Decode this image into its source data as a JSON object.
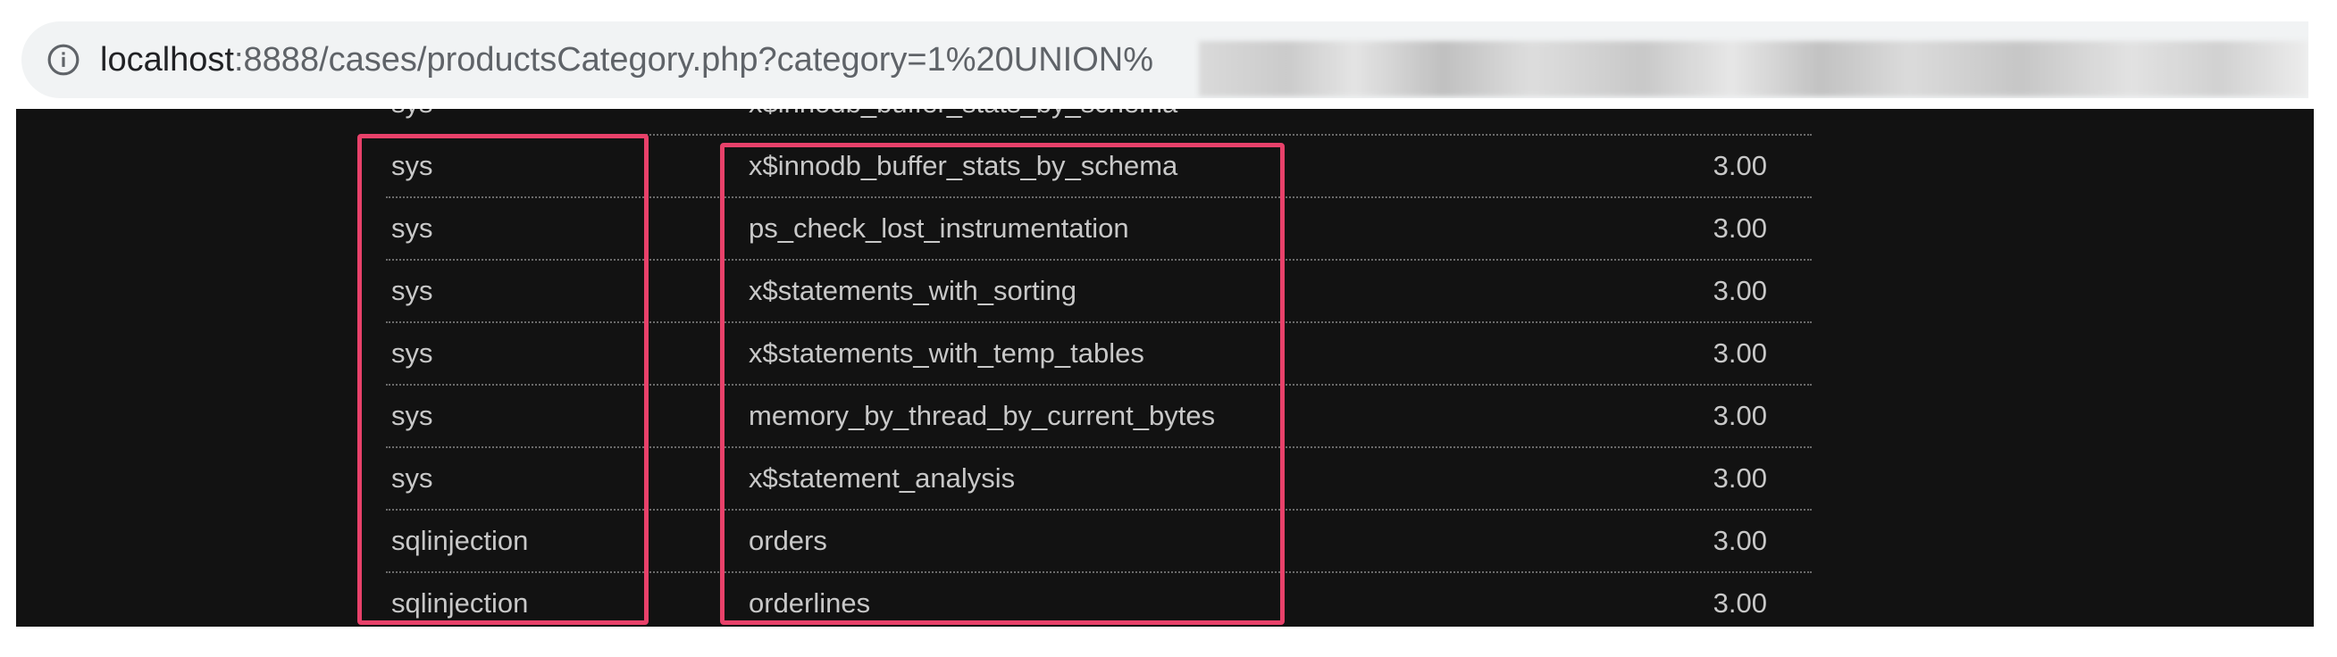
{
  "address_bar": {
    "url_host": "localhost",
    "url_rest": ":8888/cases/productsCategory.php?category=1%20UNION%"
  },
  "table": {
    "partial_row": {
      "schema": "sys",
      "table": "x$innodb_buffer_stats_by_schema",
      "value": ""
    },
    "rows": [
      {
        "schema": "sys",
        "table": "x$innodb_buffer_stats_by_schema",
        "value": "3.00"
      },
      {
        "schema": "sys",
        "table": "ps_check_lost_instrumentation",
        "value": "3.00"
      },
      {
        "schema": "sys",
        "table": "x$statements_with_sorting",
        "value": "3.00"
      },
      {
        "schema": "sys",
        "table": "x$statements_with_temp_tables",
        "value": "3.00"
      },
      {
        "schema": "sys",
        "table": "memory_by_thread_by_current_bytes",
        "value": "3.00"
      },
      {
        "schema": "sys",
        "table": "x$statement_analysis",
        "value": "3.00"
      },
      {
        "schema": "sqlinjection",
        "table": "orders",
        "value": "3.00"
      },
      {
        "schema": "sqlinjection",
        "table": "orderlines",
        "value": "3.00"
      }
    ]
  },
  "colors": {
    "highlight": "#e8416a",
    "panel_background": "#121212",
    "text": "#c8c8c8"
  },
  "icons": {
    "address_bar": "info-icon"
  }
}
